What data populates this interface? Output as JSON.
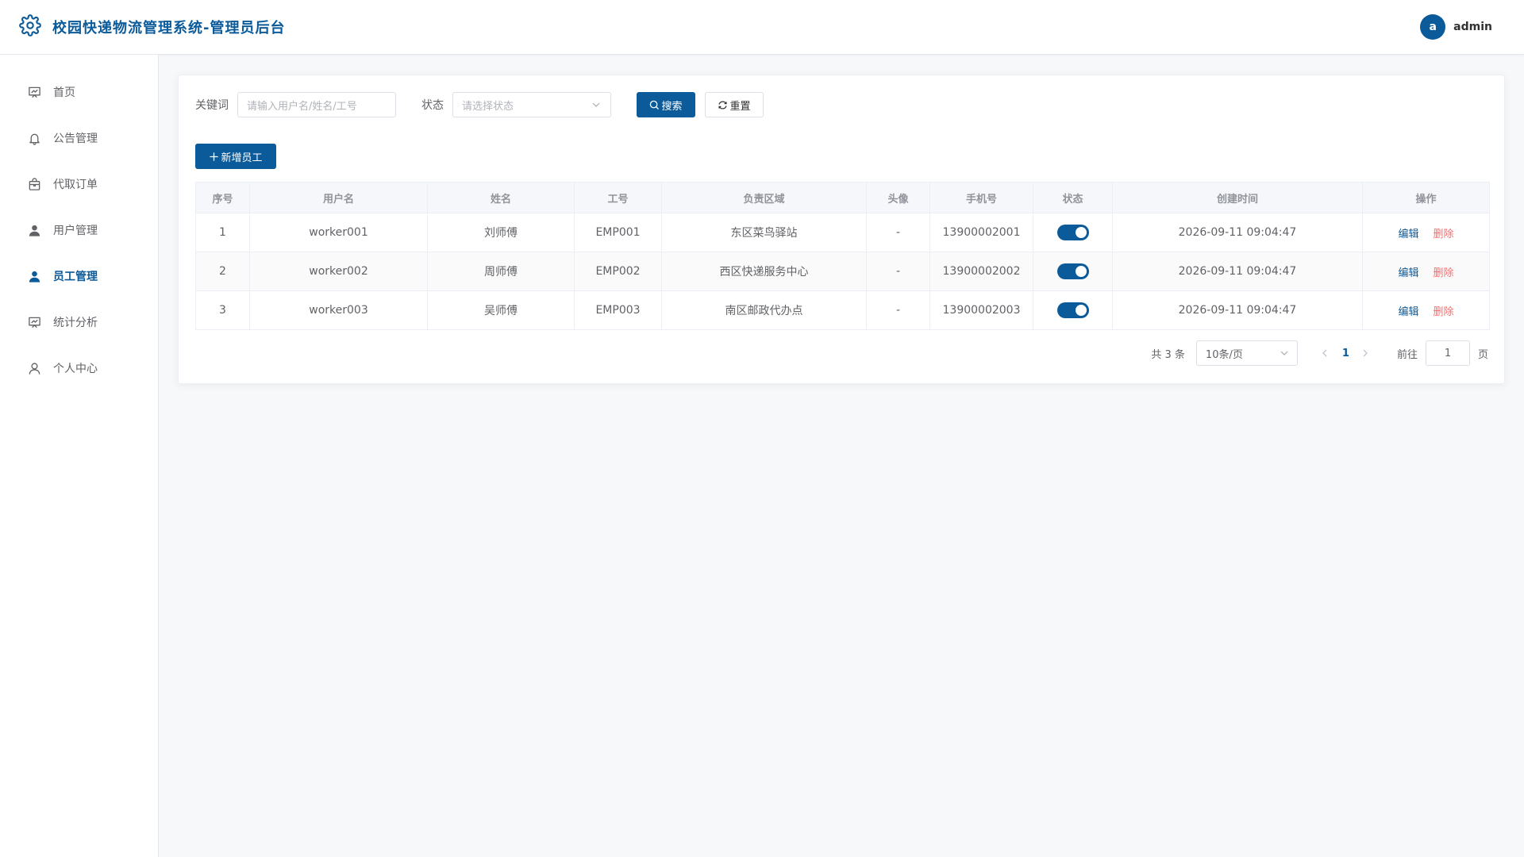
{
  "header": {
    "title": "校园快递物流管理系统-管理员后台",
    "avatar_letter": "a",
    "username": "admin"
  },
  "sidebar": {
    "items": [
      {
        "label": "首页",
        "icon": "chart-board-icon",
        "active": false
      },
      {
        "label": "公告管理",
        "icon": "bell-icon",
        "active": false
      },
      {
        "label": "代取订单",
        "icon": "package-icon",
        "active": false
      },
      {
        "label": "用户管理",
        "icon": "user-icon",
        "active": false
      },
      {
        "label": "员工管理",
        "icon": "user-icon",
        "active": true
      },
      {
        "label": "统计分析",
        "icon": "chart-board-icon",
        "active": false
      },
      {
        "label": "个人中心",
        "icon": "user-outline-icon",
        "active": false
      }
    ]
  },
  "filter": {
    "keyword_label": "关键词",
    "keyword_placeholder": "请输入用户名/姓名/工号",
    "status_label": "状态",
    "status_placeholder": "请选择状态",
    "search_label": "搜索",
    "reset_label": "重置"
  },
  "toolbar": {
    "add_label": "新增员工"
  },
  "table": {
    "columns": [
      "序号",
      "用户名",
      "姓名",
      "工号",
      "负责区域",
      "头像",
      "手机号",
      "状态",
      "创建时间",
      "操作"
    ],
    "rows": [
      {
        "index": "1",
        "username": "worker001",
        "name": "刘师傅",
        "emp_no": "EMP001",
        "area": "东区菜鸟驿站",
        "avatar": "-",
        "phone": "13900002001",
        "enabled": true,
        "created": "2026-09-11 09:04:47",
        "edit": "编辑",
        "delete": "删除"
      },
      {
        "index": "2",
        "username": "worker002",
        "name": "周师傅",
        "emp_no": "EMP002",
        "area": "西区快递服务中心",
        "avatar": "-",
        "phone": "13900002002",
        "enabled": true,
        "created": "2026-09-11 09:04:47",
        "edit": "编辑",
        "delete": "删除"
      },
      {
        "index": "3",
        "username": "worker003",
        "name": "吴师傅",
        "emp_no": "EMP003",
        "area": "南区邮政代办点",
        "avatar": "-",
        "phone": "13900002003",
        "enabled": true,
        "created": "2026-09-11 09:04:47",
        "edit": "编辑",
        "delete": "删除"
      }
    ]
  },
  "pagination": {
    "total": "共 3 条",
    "page_size": "10条/页",
    "current_page": "1",
    "goto_label": "前往",
    "goto_value": "1",
    "goto_unit": "页"
  },
  "colors": {
    "primary": "#0b5a99",
    "danger": "#f56c6c",
    "background": "#f7f8fa"
  }
}
